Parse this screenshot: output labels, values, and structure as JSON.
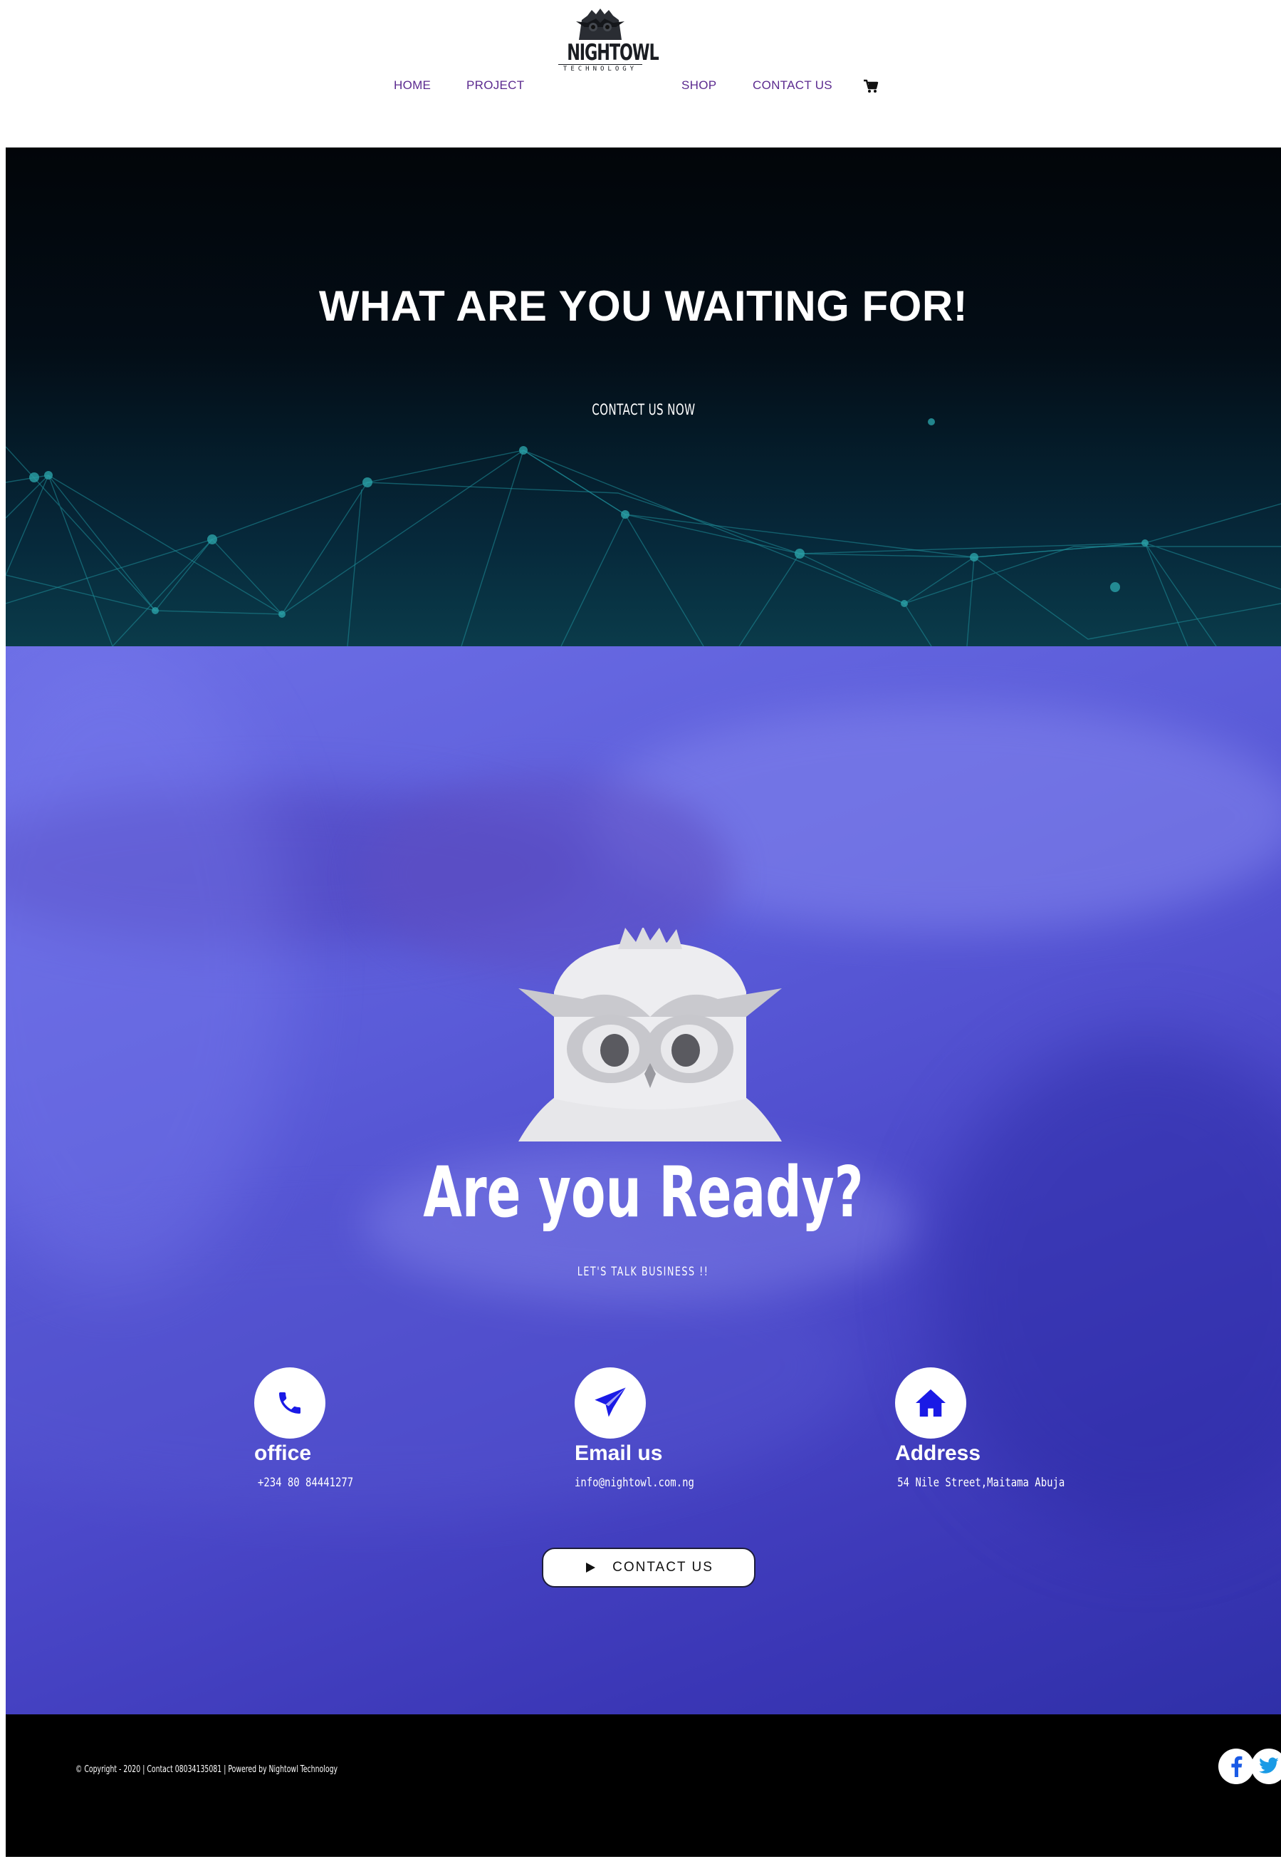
{
  "brand": {
    "name": "NIGHTOWL",
    "tagline": "TECHNOLOGY"
  },
  "nav": {
    "items": [
      {
        "label": "HOME"
      },
      {
        "label": "PROJECT"
      },
      {
        "label": "SHOP"
      },
      {
        "label": "CONTACT US"
      }
    ],
    "cart_icon": "cart-icon"
  },
  "hero": {
    "title": "WHAT ARE YOU WAITING FOR!",
    "cta": "CONTACT US NOW"
  },
  "ready": {
    "title": "Are you Ready?",
    "subtitle": "LET'S TALK BUSINESS !!",
    "contacts": [
      {
        "icon": "phone-icon",
        "label": "office",
        "value": "+234 80 84441277"
      },
      {
        "icon": "paper-plane-icon",
        "label": "Email us",
        "value": "info@nightowl.com.ng"
      },
      {
        "icon": "home-icon",
        "label": "Address",
        "value": "54 Nile Street,Maitama Abuja"
      }
    ],
    "button_label": "CONTACT US",
    "button_icon": "play-icon"
  },
  "footer": {
    "copyright": "© Copyright - 2020 | Contact 08034135081 | Powered by Nightowl Technology",
    "social": [
      "facebook-icon",
      "twitter-icon"
    ]
  },
  "colors": {
    "nav_text": "#5b2a8f",
    "overlay": "#5a5bd8",
    "icon_blue": "#1a1ae6",
    "footer_bg": "#000000"
  }
}
